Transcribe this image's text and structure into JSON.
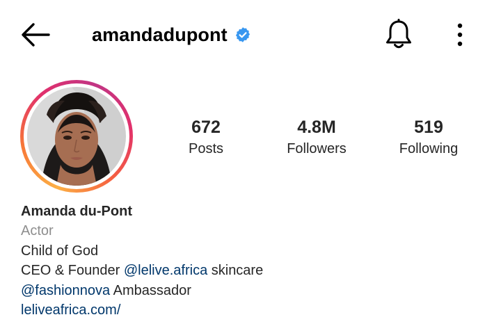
{
  "header": {
    "username": "amandadupont",
    "verified": true,
    "icons": [
      "back-arrow-icon",
      "verified-badge-icon",
      "bell-icon",
      "more-options-icon"
    ]
  },
  "stats": {
    "posts": {
      "value": "672",
      "label": "Posts"
    },
    "followers": {
      "value": "4.8M",
      "label": "Followers"
    },
    "following": {
      "value": "519",
      "label": "Following"
    }
  },
  "bio": {
    "full_name": "Amanda du-Pont",
    "category": "Actor",
    "line1": "Child of God",
    "line2_prefix": "CEO & Founder ",
    "line2_mention": "@lelive.africa",
    "line2_suffix": " skincare",
    "line3_mention": "@fashionnova",
    "line3_suffix": " Ambassador",
    "link": "leliveafrica.com/"
  },
  "colors": {
    "text": "#262626",
    "secondary": "#8e8e8e",
    "link": "#00376b",
    "verified_blue": "#3897f0",
    "story_ring": [
      "#fcaf45",
      "#f77737",
      "#e1306c",
      "#c13584"
    ]
  }
}
